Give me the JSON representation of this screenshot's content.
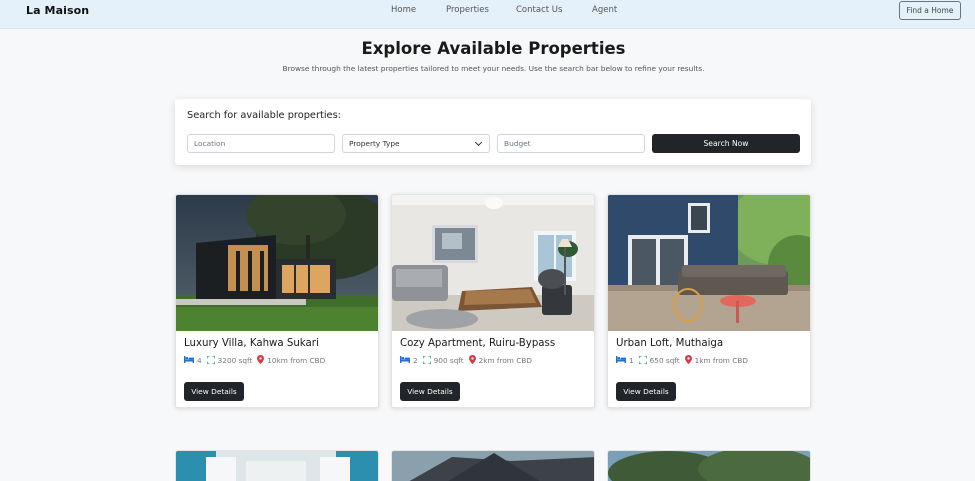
{
  "nav": {
    "brand": "La Maison",
    "links": [
      "Home",
      "Properties",
      "Contact Us",
      "Agent"
    ],
    "cta": "Find a Home"
  },
  "hero": {
    "title": "Explore Available Properties",
    "subtitle": "Browse through the latest properties tailored to meet your needs. Use the search bar below to refine your results."
  },
  "search": {
    "label": "Search for available properties:",
    "location_placeholder": "Location",
    "type_selected": "Property Type",
    "budget_placeholder": "Budget",
    "button": "Search Now"
  },
  "listings": [
    {
      "title": "Luxury Villa, Kahwa Sukari",
      "beds": "4",
      "area": "3200 sqft",
      "distance": "10km from CBD",
      "button": "View Details"
    },
    {
      "title": "Cozy Apartment, Ruiru-Bypass",
      "beds": "2",
      "area": "900 sqft",
      "distance": "2km from CBD",
      "button": "View Details"
    },
    {
      "title": "Urban Loft, Muthaiga",
      "beds": "1",
      "area": "650 sqft",
      "distance": "1km from CBD",
      "button": "View Details"
    }
  ],
  "colors": {
    "navbar_bg": "#e4f1fa",
    "primary_dark": "#212529",
    "bed_icon": "#1e6fd9",
    "area_icon": "#1aa36b",
    "pin_icon": "#dc3545"
  },
  "icons": [
    "bed-icon",
    "expand-icon",
    "location-pin-icon",
    "chevron-down-icon"
  ]
}
